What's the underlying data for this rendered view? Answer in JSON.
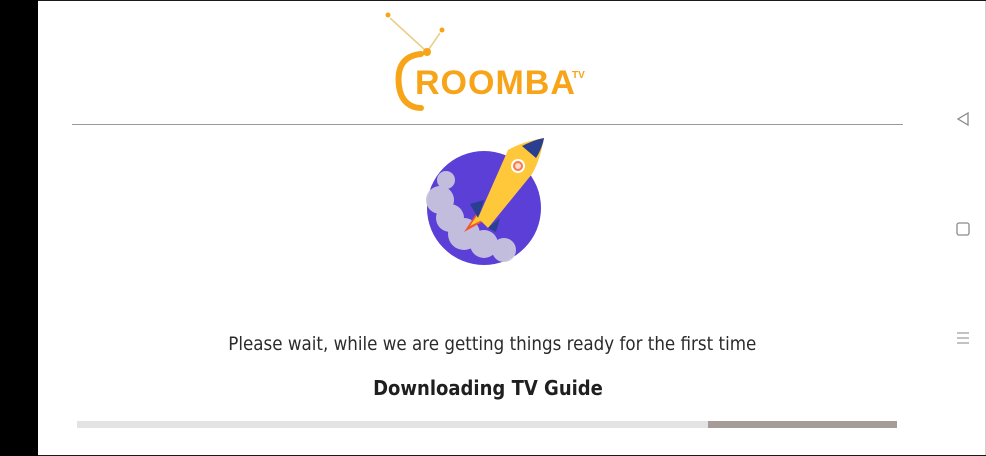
{
  "app": {
    "brand_name": "ROOMBA",
    "brand_superscript": "TV"
  },
  "main": {
    "wait_message": "Please wait, while we are getting things ready for the first time",
    "status_label": "Downloading TV Guide"
  },
  "progress": {
    "fraction_complete": 0.77
  },
  "nav": {
    "back_icon": "back-triangle-icon",
    "home_icon": "home-square-icon",
    "menu_icon": "menu-lines-icon"
  },
  "colors": {
    "brand_orange": "#f7a418",
    "rocket_circle": "#5b3fd6",
    "progress_track": "#e3e3e3",
    "progress_remaining": "#a59c98"
  }
}
